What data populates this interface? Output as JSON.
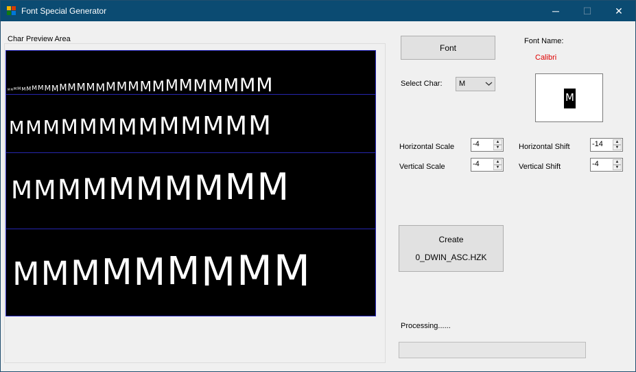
{
  "window": {
    "title": "Font Special Generator",
    "controls": {
      "minimize": "─",
      "maximize": "☐",
      "close": "✕"
    },
    "colors": {
      "titlebar": "#0b4b72",
      "preview_bg": "#000000",
      "font_name": "#e00000"
    }
  },
  "preview": {
    "group_label": "Char Preview Area",
    "glyph": "M",
    "rows": 4
  },
  "buttons": {
    "font": "Font",
    "create_line1": "Create",
    "create_line2": "0_DWIN_ASC.HZK"
  },
  "font_name": {
    "label": "Font Name:",
    "value": "Calibri"
  },
  "select_char": {
    "label": "Select Char:",
    "value": "M",
    "dropdown_icon": "chevron-down-icon"
  },
  "char_preview_box": {
    "glyph": "M"
  },
  "settings": {
    "horizontal_scale": {
      "label": "Horizontal Scale",
      "value": "-4"
    },
    "vertical_scale": {
      "label": "Vertical Scale",
      "value": "-4"
    },
    "horizontal_shift": {
      "label": "Horizontal Shift",
      "value": "-14"
    },
    "vertical_shift": {
      "label": "Vertical Shift",
      "value": "-4"
    }
  },
  "status": {
    "text": "Processing......",
    "progress": 0
  }
}
